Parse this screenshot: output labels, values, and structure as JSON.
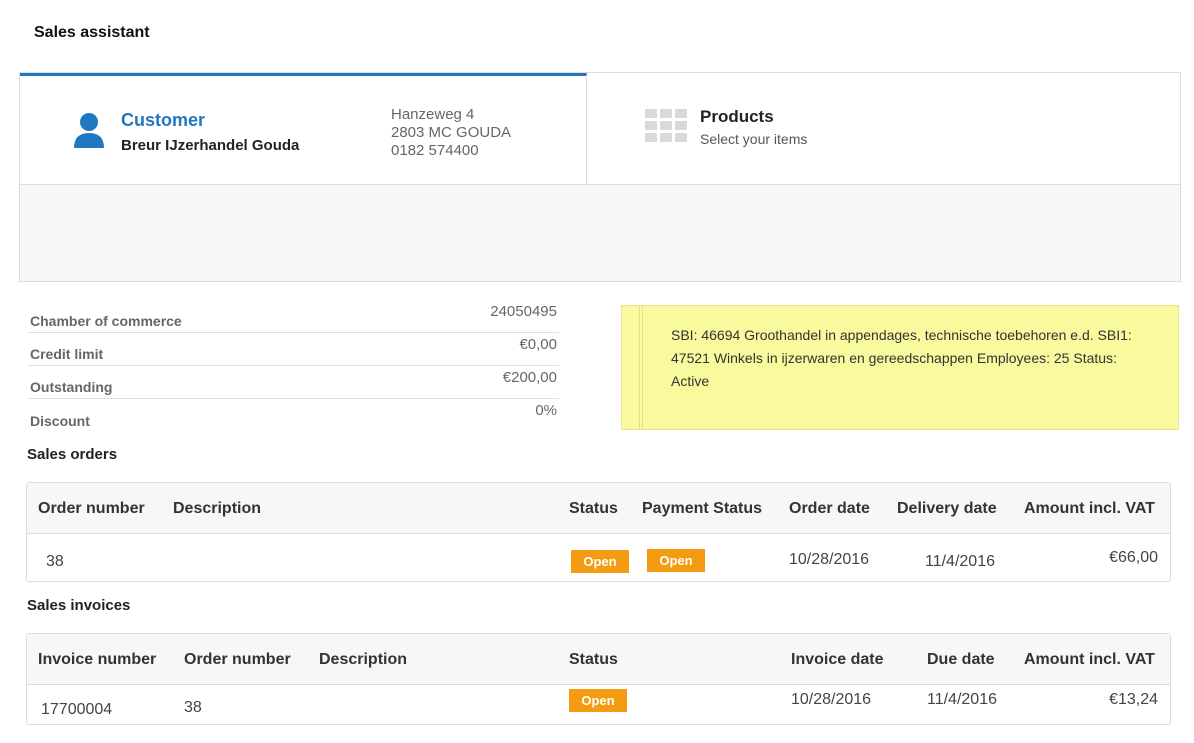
{
  "app": {
    "title": "Sales assistant"
  },
  "steps": {
    "customer": {
      "title": "Customer",
      "name": "Breur IJzerhandel Gouda",
      "address": [
        "Hanzeweg 4",
        "2803 MC GOUDA",
        "0182 574400"
      ]
    },
    "products": {
      "title": "Products",
      "subtitle": "Select your items"
    }
  },
  "info": [
    {
      "label": "Chamber of commerce",
      "value": "24050495"
    },
    {
      "label": "Credit limit",
      "value": "€0,00"
    },
    {
      "label": "Outstanding",
      "value": "€200,00"
    },
    {
      "label": "Discount",
      "value": "0%"
    }
  ],
  "note": {
    "text": "SBI: 46694 Groothandel in appendages, technische toebehoren e.d. SBI1: 47521 Winkels in ijzerwaren en gereedschappen Employees: 25 Status: Active"
  },
  "sales_orders": {
    "title": "Sales orders",
    "columns": [
      "Order number",
      "Description",
      "Status",
      "Payment Status",
      "Order date",
      "Delivery date",
      "Amount incl. VAT"
    ],
    "rows": [
      {
        "order_number": "38",
        "description": "",
        "status": "Open",
        "payment_status": "Open",
        "order_date": "10/28/2016",
        "delivery_date": "11/4/2016",
        "amount": "€66,00"
      }
    ]
  },
  "sales_invoices": {
    "title": "Sales invoices",
    "columns": [
      "Invoice number",
      "Order number",
      "Description",
      "Status",
      "Invoice date",
      "Due date",
      "Amount incl. VAT"
    ],
    "rows": [
      {
        "invoice_number": "17700004",
        "order_number": "38",
        "description": "",
        "status": "Open",
        "invoice_date": "10/28/2016",
        "due_date": "11/4/2016",
        "amount": "€13,24"
      }
    ]
  },
  "colors": {
    "accent": "#1f78c1",
    "badge": "#f39c12",
    "note_bg": "#f9f99d"
  }
}
